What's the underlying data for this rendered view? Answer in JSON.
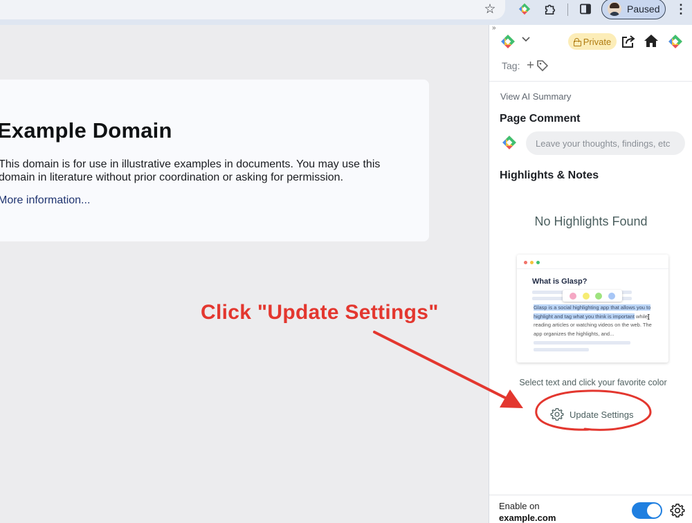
{
  "browser": {
    "profile_label": "Paused",
    "icons": [
      "star-icon",
      "glasp-extension-icon",
      "puzzle-icon",
      "side-panel-icon",
      "avatar",
      "more-vert-icon"
    ]
  },
  "page": {
    "heading": "Example Domain",
    "body": "This domain is for use in illustrative examples in documents. You may use this domain in literature without prior coordination or asking for permission.",
    "link": "More information..."
  },
  "annotation": {
    "text": "Click \"Update Settings\"",
    "color": "#e3372f"
  },
  "panel": {
    "collapse_glyph": "»",
    "private_label": "Private",
    "tag_label": "Tag:",
    "tag_add": "+",
    "ai_summary": "View AI Summary",
    "page_comment_title": "Page Comment",
    "comment_placeholder": "Leave your thoughts, findings, etc",
    "highlights_title": "Highlights & Notes",
    "no_highlights": "No Highlights Found",
    "illustration": {
      "title": "What is Glasp?",
      "highlighted_text": "Glasp is a social highlighting app that allows you to highlight and tag what you think is important",
      "rest_text": " while reading articles or watching videos on the web. The app organizes the highlights, and..."
    },
    "select_hint": "Select text and click your favorite color",
    "update_settings": "Update Settings",
    "footer": {
      "enable_label": "Enable on",
      "domain": "example.com",
      "toggle_on": true
    }
  },
  "colors": {
    "toggle": "#1f7fe0",
    "private_badge_bg": "#fcedb8",
    "highlight": "#bcd6f7"
  }
}
